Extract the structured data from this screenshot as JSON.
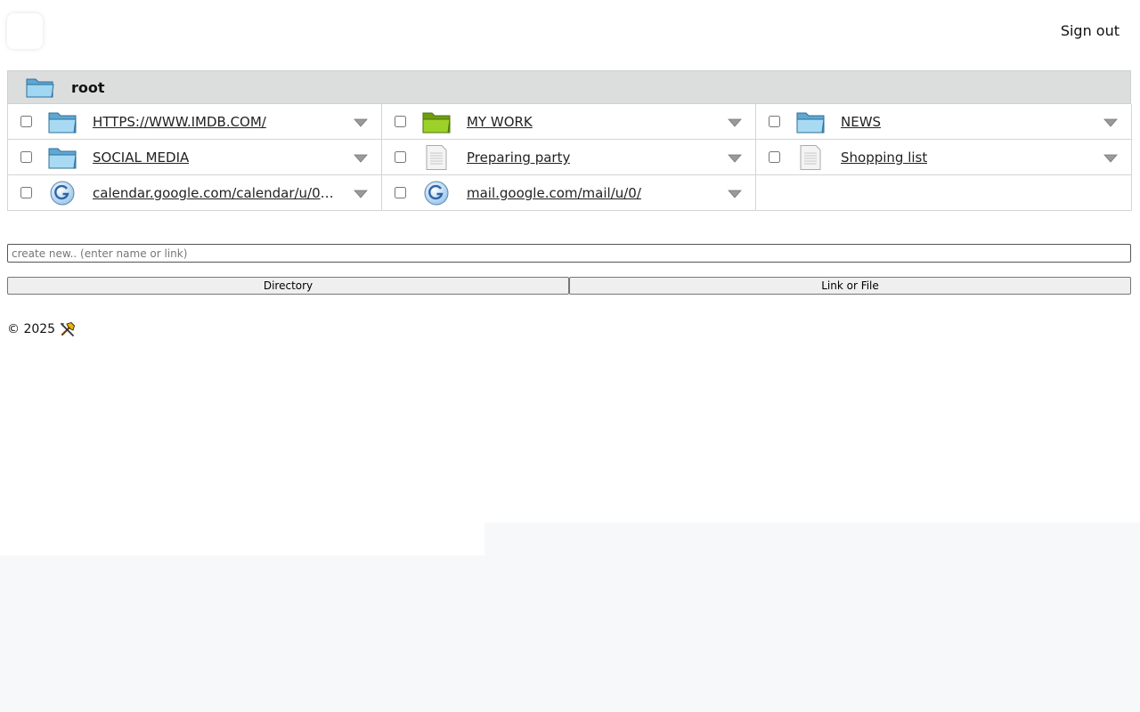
{
  "header": {
    "signout_label": "Sign out"
  },
  "root": {
    "label": "root"
  },
  "items": [
    {
      "label": "HTTPS://WWW.IMDB.COM/",
      "icon": "folder-icon",
      "kind": "folder"
    },
    {
      "label": "MY WORK",
      "icon": "folder-green-icon",
      "kind": "folder-green"
    },
    {
      "label": "NEWS",
      "icon": "folder-icon",
      "kind": "folder"
    },
    {
      "label": "SOCIAL MEDIA",
      "icon": "folder-icon",
      "kind": "folder"
    },
    {
      "label": "Preparing party",
      "icon": "document-icon",
      "kind": "doc"
    },
    {
      "label": "Shopping list",
      "icon": "document-icon",
      "kind": "doc"
    },
    {
      "label": "calendar.google.com/calendar/u/0/r...",
      "icon": "google-icon",
      "kind": "google"
    },
    {
      "label": "mail.google.com/mail/u/0/",
      "icon": "google-icon",
      "kind": "google"
    }
  ],
  "create": {
    "placeholder": "create new.. (enter name or link)",
    "directory_label": "Directory",
    "link_file_label": "Link or File"
  },
  "footer": {
    "copyright": "© 2025"
  },
  "colors": {
    "folder_blue": "#7ec3e6",
    "folder_green": "#8fc31f",
    "root_bar": "#dcdddd",
    "page_bg": "#f7f8fa"
  }
}
